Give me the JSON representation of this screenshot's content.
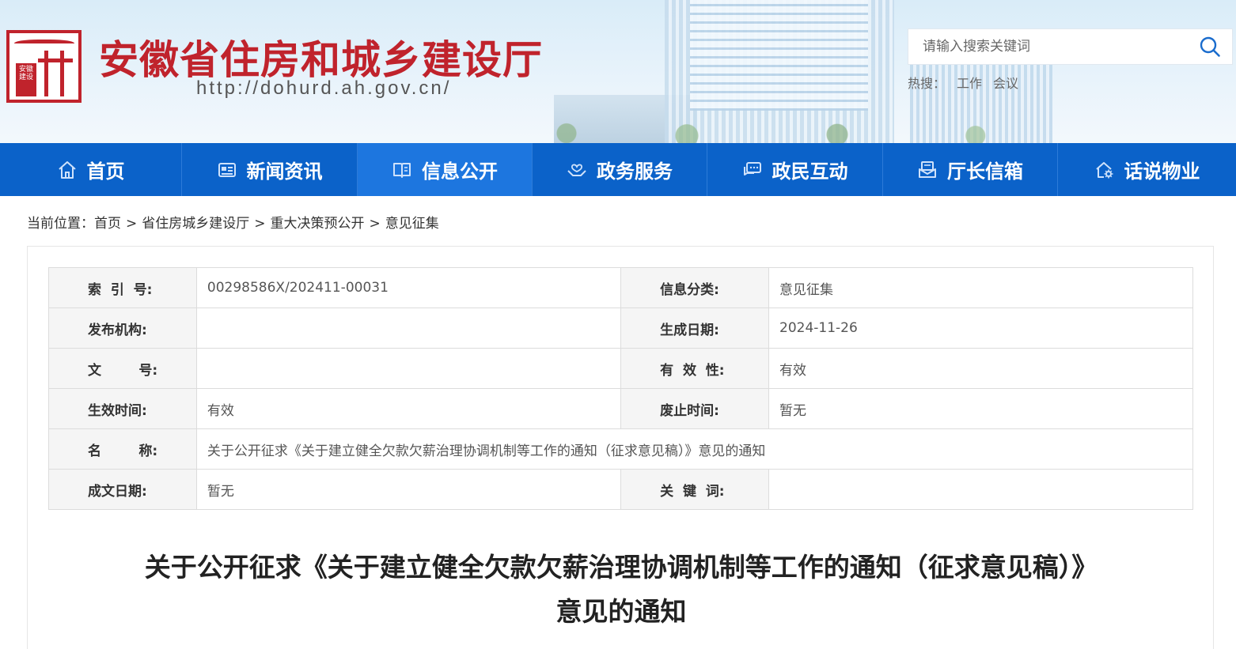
{
  "header": {
    "site_title": "安徽省住房和城乡建设厅",
    "site_url": "http://dohurd.ah.gov.cn/",
    "logo_seal_text": "安徽建设",
    "search_placeholder": "请输入搜索关键词",
    "hot_label": "热搜：",
    "hot_words": [
      "工作",
      "会议"
    ]
  },
  "nav": [
    {
      "label": "首页",
      "icon": "home-icon"
    },
    {
      "label": "新闻资讯",
      "icon": "newspaper-icon"
    },
    {
      "label": "信息公开",
      "icon": "book-icon"
    },
    {
      "label": "政务服务",
      "icon": "hands-heart-icon"
    },
    {
      "label": "政民互动",
      "icon": "chat-icon"
    },
    {
      "label": "厅长信箱",
      "icon": "mailbox-icon"
    },
    {
      "label": "话说物业",
      "icon": "house-gear-icon"
    }
  ],
  "nav_active_index": 2,
  "breadcrumb": {
    "label": "当前位置：",
    "items": [
      "首页",
      "省住房城乡建设厅",
      "重大决策预公开",
      "意见征集"
    ],
    "separator": ">"
  },
  "meta": {
    "index_no_label": "索  引  号:",
    "index_no": "00298586X/202411-00031",
    "category_label": "信息分类:",
    "category": "意见征集",
    "publisher_label": "发布机构:",
    "publisher": "",
    "created_date_label": "生成日期:",
    "created_date": "2024-11-26",
    "doc_no_label": "文        号:",
    "doc_no": "",
    "validity_label": "有  效  性:",
    "validity": "有效",
    "effective_time_label": "生效时间:",
    "effective_time": "有效",
    "repeal_time_label": "废止时间:",
    "repeal_time": "暂无",
    "name_label": "名        称:",
    "name": "关于公开征求《关于建立健全欠款欠薪治理协调机制等工作的通知（征求意见稿）》意见的通知",
    "written_date_label": "成文日期:",
    "written_date": "暂无",
    "keywords_label": "关  键  词:",
    "keywords": ""
  },
  "document": {
    "title_line1": "关于公开征求《关于建立健全欠款欠薪治理协调机制等工作的通知（征求意见稿）》",
    "title_line2": "意见的通知"
  },
  "colors": {
    "brand_red": "#c0232c",
    "nav_blue": "#0b62c9",
    "nav_active_blue": "#1d76df"
  }
}
